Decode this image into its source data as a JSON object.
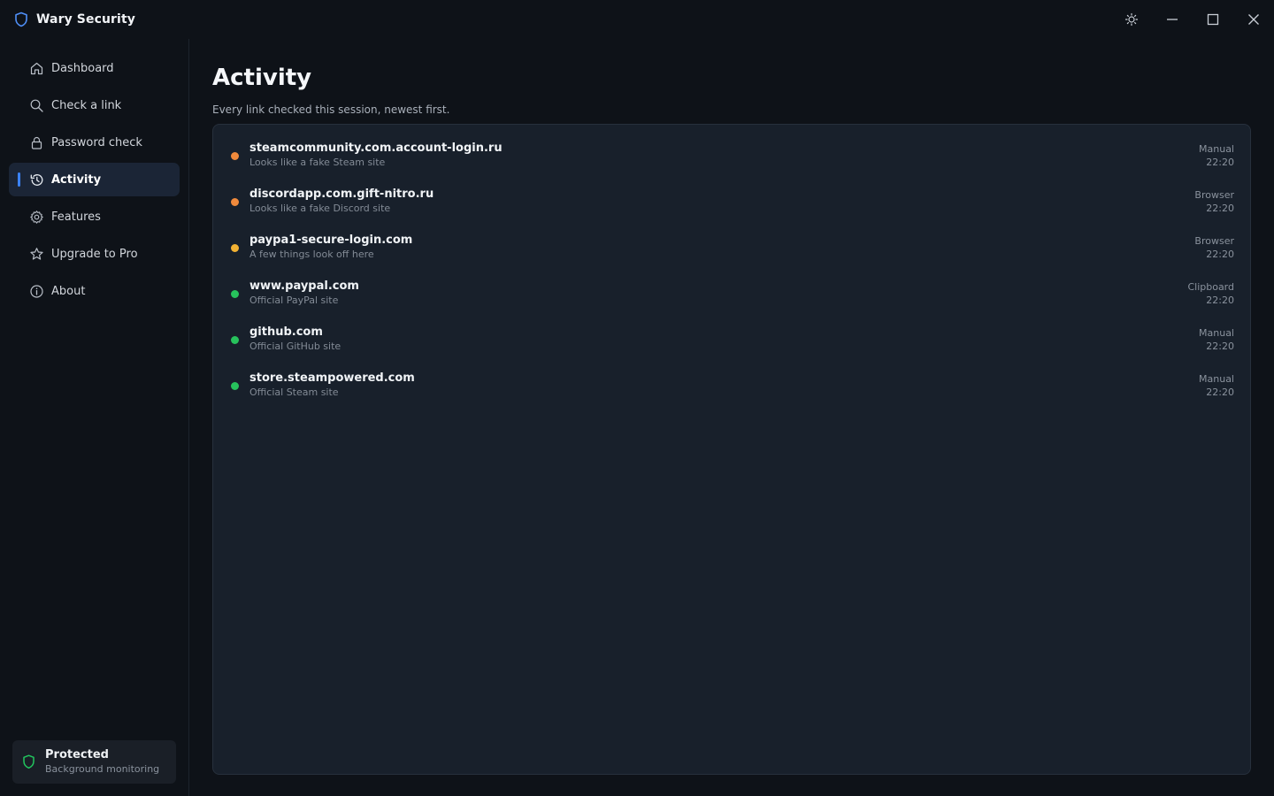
{
  "app": {
    "title": "Wary Security"
  },
  "colors": {
    "accent": "#3b82f6",
    "danger": "#f08a3c",
    "warning": "#f2b233",
    "safe": "#27c25c",
    "protected": "#22c55e"
  },
  "sidebar": {
    "items": [
      {
        "label": "Dashboard",
        "icon": "home-icon"
      },
      {
        "label": "Check a link",
        "icon": "search-icon"
      },
      {
        "label": "Password check",
        "icon": "lock-icon"
      },
      {
        "label": "Activity",
        "icon": "history-icon",
        "active": true
      },
      {
        "label": "Features",
        "icon": "gear-icon"
      },
      {
        "label": "Upgrade to Pro",
        "icon": "star-icon"
      },
      {
        "label": "About",
        "icon": "info-icon"
      }
    ],
    "status": {
      "title": "Protected",
      "subtitle": "Background monitoring"
    }
  },
  "main": {
    "title": "Activity",
    "subtitle": "Every link checked this session, newest first.",
    "activity": [
      {
        "url": "steamcommunity.com.account-login.ru",
        "description": "Looks like a fake Steam site",
        "source": "Manual",
        "time": "22:20",
        "status": "danger"
      },
      {
        "url": "discordapp.com.gift-nitro.ru",
        "description": "Looks like a fake Discord site",
        "source": "Browser",
        "time": "22:20",
        "status": "danger"
      },
      {
        "url": "paypa1-secure-login.com",
        "description": "A few things look off here",
        "source": "Browser",
        "time": "22:20",
        "status": "warning"
      },
      {
        "url": "www.paypal.com",
        "description": "Official PayPal site",
        "source": "Clipboard",
        "time": "22:20",
        "status": "safe"
      },
      {
        "url": "github.com",
        "description": "Official GitHub site",
        "source": "Manual",
        "time": "22:20",
        "status": "safe"
      },
      {
        "url": "store.steampowered.com",
        "description": "Official Steam site",
        "source": "Manual",
        "time": "22:20",
        "status": "safe"
      }
    ]
  }
}
